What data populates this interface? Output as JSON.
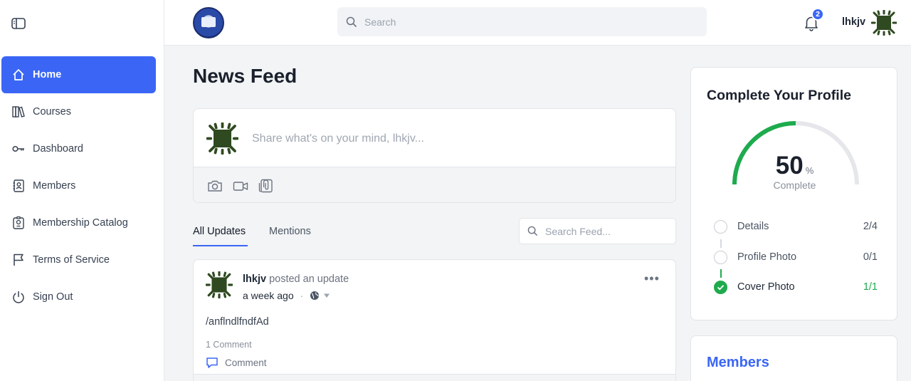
{
  "sidebar": {
    "items": [
      {
        "label": "Home",
        "icon": "home-icon",
        "active": true
      },
      {
        "label": "Courses",
        "icon": "books-icon"
      },
      {
        "label": "Dashboard",
        "icon": "key-icon"
      },
      {
        "label": "Members",
        "icon": "contacts-icon"
      },
      {
        "label": "Membership Catalog",
        "icon": "id-badge-icon"
      },
      {
        "label": "Terms of Service",
        "icon": "flag-icon"
      },
      {
        "label": "Sign Out",
        "icon": "power-icon"
      }
    ]
  },
  "header": {
    "search_placeholder": "Search",
    "notification_count": "2",
    "user_name": "lhkjv"
  },
  "main": {
    "title": "News Feed",
    "composer_placeholder": "Share what's on your mind, lhkjv...",
    "tabs": [
      {
        "label": "All Updates",
        "active": true
      },
      {
        "label": "Mentions"
      }
    ],
    "feed_search_placeholder": "Search Feed...",
    "post": {
      "author": "lhkjv",
      "action": "posted an update",
      "time": "a week ago",
      "body": "/anflndlfndfAd",
      "comment_count": "1 Comment",
      "comment_label": "Comment"
    }
  },
  "profile": {
    "title": "Complete Your Profile",
    "percent": "50",
    "percent_unit": "%",
    "complete_label": "Complete",
    "steps": [
      {
        "label": "Details",
        "count": "2/4",
        "done": false
      },
      {
        "label": "Profile Photo",
        "count": "0/1",
        "done": false
      },
      {
        "label": "Cover Photo",
        "count": "1/1",
        "done": true
      }
    ]
  },
  "members": {
    "title": "Members"
  },
  "colors": {
    "accent": "#3b66f5",
    "success": "#1eab4d"
  }
}
